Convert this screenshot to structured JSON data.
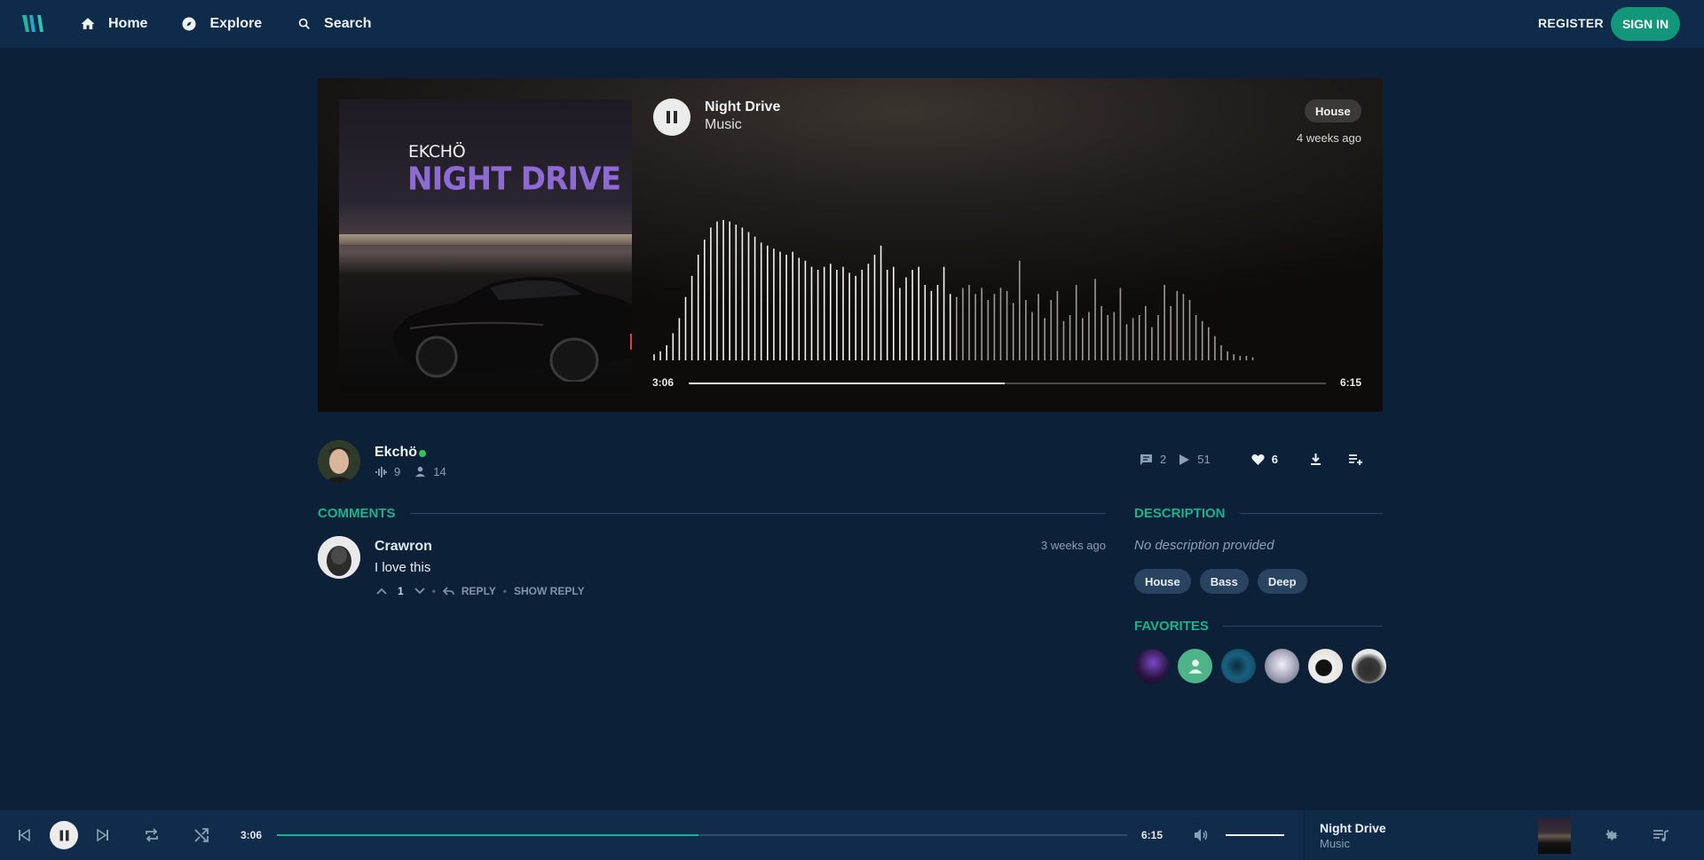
{
  "nav": {
    "home_label": "Home",
    "explore_label": "Explore",
    "search_label": "Search",
    "register_label": "REGISTER",
    "signin_label": "SIGN IN"
  },
  "cover": {
    "artist_text": "EKCHÖ",
    "title_text": "NIGHT DRIVE"
  },
  "track": {
    "title": "Night Drive",
    "subtitle": "Music",
    "genre": "House",
    "uploaded": "4 weeks ago",
    "current_time": "3:06",
    "duration": "6:15",
    "progress_fraction": 0.496
  },
  "artist": {
    "name": "Ekchö",
    "online": true,
    "tracks_count": "9",
    "followers_count": "14"
  },
  "stats": {
    "comments": "2",
    "plays": "51",
    "likes": "6"
  },
  "comments": {
    "heading": "COMMENTS",
    "items": [
      {
        "user": "Crawron",
        "date": "3 weeks ago",
        "text": "I love this",
        "votes": "1",
        "reply_label": "REPLY",
        "show_reply_label": "SHOW REPLY"
      }
    ]
  },
  "description": {
    "heading": "DESCRIPTION",
    "text": "No description provided",
    "tags": [
      "House",
      "Bass",
      "Deep"
    ]
  },
  "favorites": {
    "heading": "FAVORITES",
    "avatars": [
      "#1e1633",
      "#4fb38a",
      "#1a5a7a",
      "#b8b8c8",
      "#e8e4e0",
      "#d9d9d9"
    ]
  },
  "player": {
    "current_time": "3:06",
    "duration": "6:15",
    "progress_fraction": 0.496,
    "volume_fraction": 1.0,
    "now_playing_title": "Night Drive",
    "now_playing_sub": "Music"
  },
  "colors": {
    "accent": "#18b28e",
    "background": "#0c2038",
    "topbar": "#0f2b4a",
    "online": "#35c25a"
  },
  "waveform": {
    "heights": [
      0.04,
      0.06,
      0.1,
      0.18,
      0.28,
      0.42,
      0.56,
      0.7,
      0.8,
      0.88,
      0.92,
      0.93,
      0.92,
      0.9,
      0.88,
      0.85,
      0.82,
      0.78,
      0.76,
      0.74,
      0.72,
      0.7,
      0.72,
      0.68,
      0.66,
      0.62,
      0.6,
      0.62,
      0.64,
      0.6,
      0.62,
      0.58,
      0.56,
      0.6,
      0.64,
      0.7,
      0.76,
      0.6,
      0.62,
      0.48,
      0.55,
      0.6,
      0.62,
      0.5,
      0.46,
      0.5,
      0.62,
      0.44,
      0.42,
      0.48,
      0.5,
      0.44,
      0.48,
      0.4,
      0.44,
      0.48,
      0.46,
      0.38,
      0.66,
      0.4,
      0.32,
      0.44,
      0.28,
      0.4,
      0.46,
      0.26,
      0.3,
      0.5,
      0.28,
      0.32,
      0.54,
      0.36,
      0.3,
      0.32,
      0.48,
      0.24,
      0.28,
      0.3,
      0.36,
      0.22,
      0.3,
      0.5,
      0.36,
      0.46,
      0.44,
      0.4,
      0.3,
      0.26,
      0.22,
      0.16,
      0.1,
      0.06,
      0.04,
      0.03,
      0.03,
      0.02
    ]
  }
}
